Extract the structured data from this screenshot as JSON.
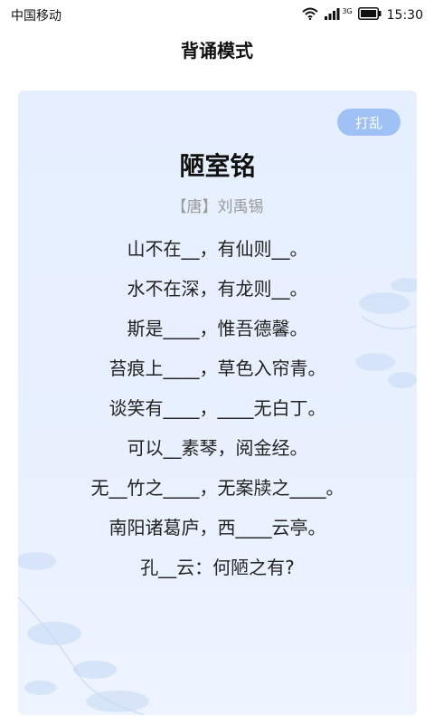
{
  "status_bar": {
    "carrier": "中国移动",
    "network_type": "3G",
    "time": "15:30"
  },
  "header": {
    "title": "背诵模式"
  },
  "card": {
    "shuffle_label": "打乱",
    "poem_title": "陋室铭",
    "author": "【唐】刘禹锡",
    "lines": [
      "山不在__，有仙则__。",
      "水不在深，有龙则__。",
      "斯是____，惟吾德馨。",
      "苔痕上____，草色入帘青。",
      "谈笑有____，____无白丁。",
      "可以__素琴，阅金经。",
      "无__竹之____，无案牍之____。",
      "南阳诸葛庐，西____云亭。",
      "孔__云：何陋之有?"
    ]
  },
  "colors": {
    "card_background": "#e6efff",
    "shuffle_button": "#9fc1f5",
    "author_text": "#9a9a9a"
  },
  "icons": [
    "wifi-icon",
    "signal-icon",
    "battery-icon"
  ]
}
